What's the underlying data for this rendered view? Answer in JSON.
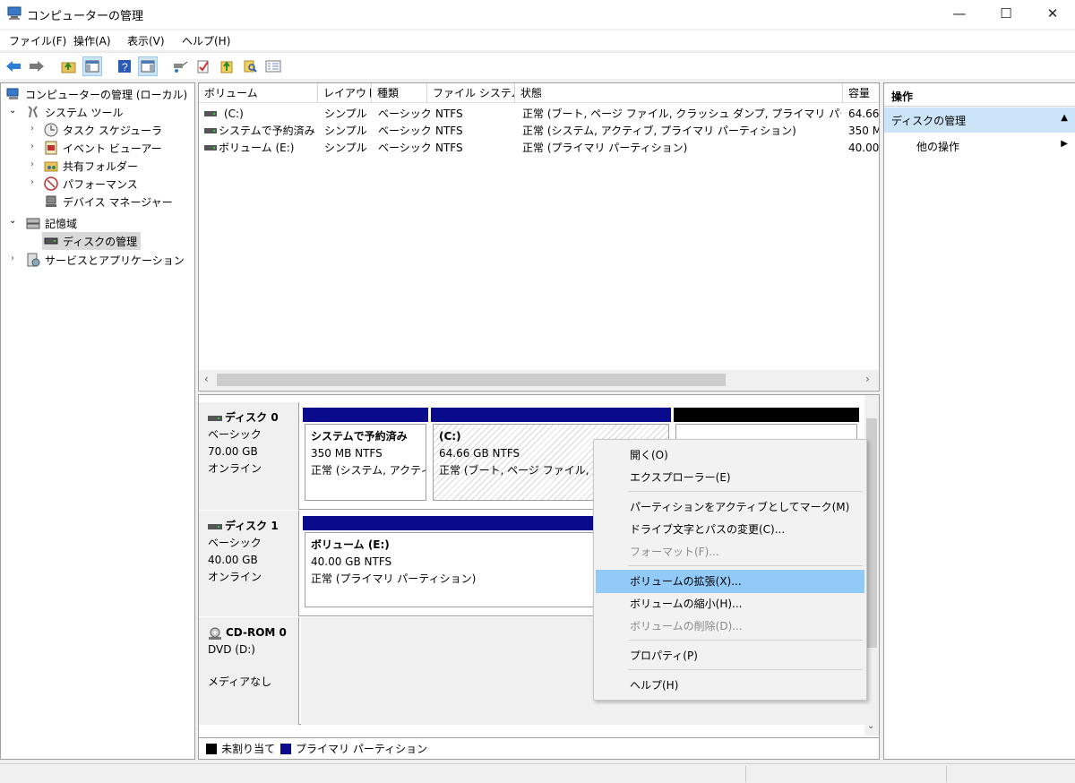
{
  "window": {
    "title": "コンピューターの管理",
    "minimize": "—",
    "maximize": "☐",
    "close": "✕"
  },
  "menu": [
    "ファイル(F)",
    "操作(A)",
    "表示(V)",
    "ヘルプ(H)"
  ],
  "toolbar_icons": [
    "back-arrow-icon",
    "forward-arrow-icon",
    "up-folder-icon",
    "show-hide-tree-icon",
    "help-icon",
    "show-hide-action-icon",
    "connect-icon",
    "check-icon",
    "export-icon",
    "search-icon",
    "properties-icon"
  ],
  "tree": {
    "root": "コンピューターの管理 (ローカル)",
    "system_tools": "システム ツール",
    "task_scheduler": "タスク スケジューラ",
    "event_viewer": "イベント ビューアー",
    "shared_folders": "共有フォルダー",
    "performance": "パフォーマンス",
    "device_manager": "デバイス マネージャー",
    "storage": "記憶域",
    "disk_management": "ディスクの管理",
    "services_apps": "サービスとアプリケーション"
  },
  "volume_table": {
    "headers": [
      "ボリューム",
      "レイアウト",
      "種類",
      "ファイル システム",
      "状態",
      "容量"
    ],
    "rows": [
      [
        "(C:)",
        "シンプル",
        "ベーシック",
        "NTFS",
        "正常 (ブート, ページ ファイル, クラッシュ ダンプ, プライマリ パーティション)",
        "64.66"
      ],
      [
        "システムで予約済み",
        "シンプル",
        "ベーシック",
        "NTFS",
        "正常 (システム, アクティブ, プライマリ パーティション)",
        "350 M"
      ],
      [
        "ボリューム (E:)",
        "シンプル",
        "ベーシック",
        "NTFS",
        "正常 (プライマリ パーティション)",
        "40.00"
      ]
    ]
  },
  "disks": {
    "disk0": {
      "name": "ディスク 0",
      "type": "ベーシック",
      "size": "70.00 GB",
      "status": "オンライン",
      "p1": {
        "name": "システムで予約済み",
        "size": "350 MB NTFS",
        "status": "正常 (システム, アクティブ"
      },
      "p2": {
        "name": "(C:)",
        "size": "64.66 GB NTFS",
        "status": "正常 (ブート, ページ ファイル, クラッシ"
      }
    },
    "disk1": {
      "name": "ディスク 1",
      "type": "ベーシック",
      "size": "40.00 GB",
      "status": "オンライン",
      "p1": {
        "name": "ボリューム  (E:)",
        "size": "40.00 GB NTFS",
        "status": "正常 (プライマリ パーティション)"
      }
    },
    "cdrom": {
      "name": "CD-ROM 0",
      "type": "DVD (D:)",
      "status": "メディアなし"
    }
  },
  "legend": {
    "unallocated": "未割り当て",
    "primary": "プライマリ パーティション"
  },
  "actions": {
    "title": "操作",
    "section": "ディスクの管理",
    "other": "他の操作"
  },
  "context_menu": [
    {
      "label": "開く(O)",
      "disabled": false
    },
    {
      "label": "エクスプローラー(E)",
      "disabled": false
    },
    {
      "label": "パーティションをアクティブとしてマーク(M)",
      "disabled": false
    },
    {
      "label": "ドライブ文字とパスの変更(C)...",
      "disabled": false
    },
    {
      "label": "フォーマット(F)...",
      "disabled": true
    },
    {
      "label": "ボリュームの拡張(X)...",
      "disabled": false,
      "highlighted": true
    },
    {
      "label": "ボリュームの縮小(H)...",
      "disabled": false
    },
    {
      "label": "ボリュームの削除(D)...",
      "disabled": true
    },
    {
      "label": "プロパティ(P)",
      "disabled": false
    },
    {
      "label": "ヘルプ(H)",
      "disabled": false
    }
  ],
  "colors": {
    "primary_partition": "#0a0a8c",
    "unallocated": "#000000",
    "highlight": "#91c9f7",
    "selection_header": "#cce4f7"
  }
}
